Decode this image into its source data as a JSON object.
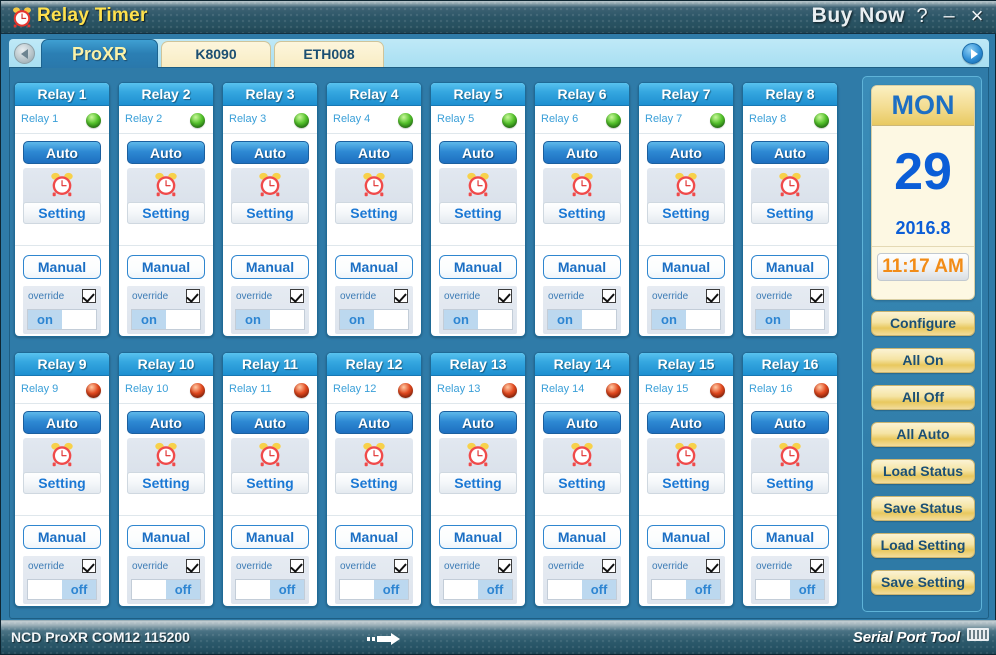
{
  "window": {
    "title": "Relay Timer",
    "title_icon": "alarm-clock-icon",
    "buy_now": "Buy Now",
    "help": "?",
    "minimize": "–",
    "close": "×",
    "title_color": "#ffe14d"
  },
  "tabs": [
    {
      "label": "ProXR",
      "active": true
    },
    {
      "label": "K8090",
      "active": false
    },
    {
      "label": "ETH008",
      "active": false
    }
  ],
  "tab_nav": {
    "prev_icon": "chevron-left-icon",
    "next_icon": "chevron-right-icon"
  },
  "panel_common": {
    "auto_label": "Auto",
    "setting_label": "Setting",
    "manual_label": "Manual",
    "override_label": "override",
    "on_label": "on",
    "off_label": "off",
    "clock_icon": "alarm-clock-icon",
    "led_on_color": "#55c32c",
    "led_off_color": "#e2491f"
  },
  "relays": [
    {
      "header": "Relay 1",
      "name": "Relay 1",
      "led": "on",
      "state": "on",
      "override": true,
      "auto": "Auto",
      "setting": "Setting",
      "manual": "Manual"
    },
    {
      "header": "Relay 2",
      "name": "Relay 2",
      "led": "on",
      "state": "on",
      "override": true,
      "auto": "Auto",
      "setting": "Setting",
      "manual": "Manual"
    },
    {
      "header": "Relay 3",
      "name": "Relay 3",
      "led": "on",
      "state": "on",
      "override": true,
      "auto": "Auto",
      "setting": "Setting",
      "manual": "Manual"
    },
    {
      "header": "Relay 4",
      "name": "Relay 4",
      "led": "on",
      "state": "on",
      "override": true,
      "auto": "Auto",
      "setting": "Setting",
      "manual": "Manual"
    },
    {
      "header": "Relay 5",
      "name": "Relay 5",
      "led": "on",
      "state": "on",
      "override": true,
      "auto": "Auto",
      "setting": "Setting",
      "manual": "Manual"
    },
    {
      "header": "Relay 6",
      "name": "Relay 6",
      "led": "on",
      "state": "on",
      "override": true,
      "auto": "Auto",
      "setting": "Setting",
      "manual": "Manual"
    },
    {
      "header": "Relay 7",
      "name": "Relay 7",
      "led": "on",
      "state": "on",
      "override": true,
      "auto": "Auto",
      "setting": "Setting",
      "manual": "Manual"
    },
    {
      "header": "Relay 8",
      "name": "Relay 8",
      "led": "on",
      "state": "on",
      "override": true,
      "auto": "Auto",
      "setting": "Setting",
      "manual": "Manual"
    },
    {
      "header": "Relay 9",
      "name": "Relay 9",
      "led": "off",
      "state": "off",
      "override": true,
      "auto": "Auto",
      "setting": "Setting",
      "manual": "Manual"
    },
    {
      "header": "Relay 10",
      "name": "Relay 10",
      "led": "off",
      "state": "off",
      "override": true,
      "auto": "Auto",
      "setting": "Setting",
      "manual": "Manual"
    },
    {
      "header": "Relay 11",
      "name": "Relay 11",
      "led": "off",
      "state": "off",
      "override": true,
      "auto": "Auto",
      "setting": "Setting",
      "manual": "Manual"
    },
    {
      "header": "Relay 12",
      "name": "Relay 12",
      "led": "off",
      "state": "off",
      "override": true,
      "auto": "Auto",
      "setting": "Setting",
      "manual": "Manual"
    },
    {
      "header": "Relay 13",
      "name": "Relay 13",
      "led": "off",
      "state": "off",
      "override": true,
      "auto": "Auto",
      "setting": "Setting",
      "manual": "Manual"
    },
    {
      "header": "Relay 14",
      "name": "Relay 14",
      "led": "off",
      "state": "off",
      "override": true,
      "auto": "Auto",
      "setting": "Setting",
      "manual": "Manual"
    },
    {
      "header": "Relay 15",
      "name": "Relay 15",
      "led": "off",
      "state": "off",
      "override": true,
      "auto": "Auto",
      "setting": "Setting",
      "manual": "Manual"
    },
    {
      "header": "Relay 16",
      "name": "Relay 16",
      "led": "off",
      "state": "off",
      "override": true,
      "auto": "Auto",
      "setting": "Setting",
      "manual": "Manual"
    }
  ],
  "calendar": {
    "weekday": "MON",
    "day": "29",
    "year_month": "2016.8",
    "time": "11:17 AM",
    "time_color": "#f28c17",
    "day_color": "#0b5ed7"
  },
  "sidebar_buttons": [
    {
      "label": "Configure"
    },
    {
      "label": "All On"
    },
    {
      "label": "All Off"
    },
    {
      "label": "All Auto"
    },
    {
      "label": "Load Status"
    },
    {
      "label": "Save Status"
    },
    {
      "label": "Load Setting"
    },
    {
      "label": "Save Setting"
    }
  ],
  "statusbar": {
    "text": "NCD ProXR COM12 115200",
    "tx_icon": "transmit-arrow-icon",
    "logo": "Serial Port Tool"
  }
}
